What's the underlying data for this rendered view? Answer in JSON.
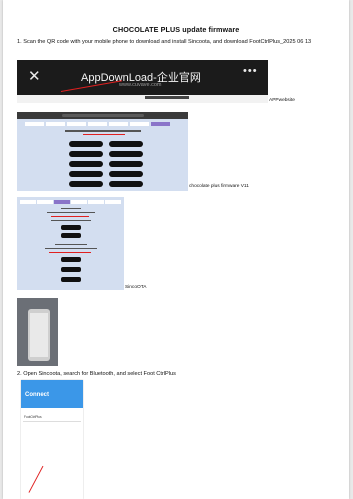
{
  "document": {
    "title": "CHOCOLATE PLUS update firmware",
    "step1": "1.  Scan the QR code with your mobile phone to download and install Sincoota, and download FootCtrlPlus_2025 06 13",
    "step2": "2.  Open Sincoota, search for Bluetooth, and select Foot CtrlPlus"
  },
  "figures": {
    "browser_bar": {
      "site_title": "AppDownLoad-企业官网",
      "url": "www.cuvave.com",
      "caption": "APPwebsite",
      "close_icon": "close-icon",
      "more_icon": "more-dots-icon"
    },
    "download_page": {
      "caption": "chocolate plus firmware V11"
    },
    "ota_page": {
      "caption": "SincoOTA"
    },
    "connect_screen": {
      "title": "Connect",
      "row_label": "FootCtrlPlus"
    }
  },
  "colors": {
    "annotation_red": "#e02020",
    "dark_bar": "#1b1b1b",
    "web_background": "#d3def0",
    "active_tab": "#8a74c9",
    "app_blue": "#3b97e8"
  }
}
